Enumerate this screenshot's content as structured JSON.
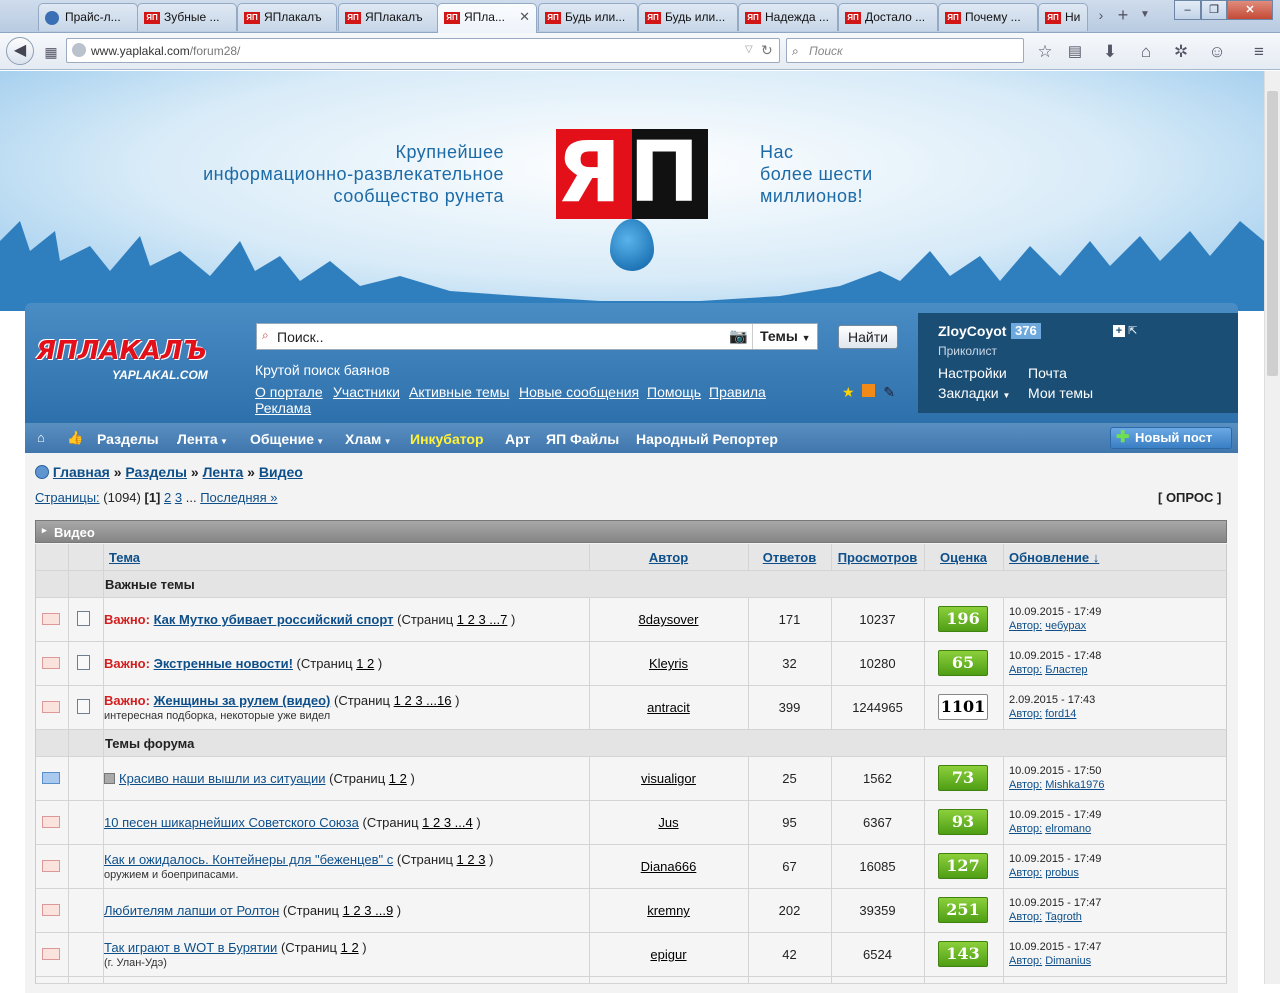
{
  "browser": {
    "tabs": [
      {
        "label": "Прайс-л...",
        "icon": "globe"
      },
      {
        "label": "Зубные ...",
        "icon": "ЯП"
      },
      {
        "label": "ЯПлакалъ",
        "icon": "ЯП"
      },
      {
        "label": "ЯПлакалъ",
        "icon": "ЯП"
      },
      {
        "label": "ЯПла...",
        "icon": "ЯП"
      },
      {
        "label": "Будь или...",
        "icon": "ЯП"
      },
      {
        "label": "Будь или...",
        "icon": "ЯП"
      },
      {
        "label": "Надежда ...",
        "icon": "ЯП"
      },
      {
        "label": "Достало ...",
        "icon": "ЯП"
      },
      {
        "label": "Почему ...",
        "icon": "ЯП"
      },
      {
        "label": "Ни",
        "icon": "ЯП"
      }
    ],
    "url_prefix": "www.yaplakal.com",
    "url_path": "/forum28/",
    "search_placeholder": "Поиск"
  },
  "hero": {
    "slogan_left": [
      "Крупнейшее",
      "информационно-развлекательное",
      "сообщество рунета"
    ],
    "slogan_right": [
      "Нас",
      "более шести",
      "миллионов!"
    ],
    "logo_text": "ЯП"
  },
  "header": {
    "site_logo": "ЯПЛАКАЛЪ",
    "site_logo_sub": "YAPLAKAL.COM",
    "search_placeholder": "Поиск..",
    "search_scope": "Темы",
    "search_button": "Найти",
    "tagline": "Крутой поиск баянов",
    "links": [
      "О портале",
      "Участники",
      "Активные темы",
      "Новые сообщения",
      "Помощь",
      "Правила",
      "Реклама"
    ]
  },
  "user": {
    "name": "ZloyCoyot",
    "karma": "376",
    "rank": "Приколист",
    "settings": "Настройки",
    "mail": "Почта",
    "bookmarks": "Закладки",
    "my_topics": "Мои темы"
  },
  "menu": {
    "items": [
      "Разделы",
      "Лента",
      "Общение",
      "Хлам",
      "Инкубатор",
      "Арт",
      "ЯП Файлы",
      "Народный Репортер"
    ],
    "new_post": "Новый пост"
  },
  "crumbs": [
    "Главная",
    "Разделы",
    "Лента",
    "Видео"
  ],
  "pager": {
    "label": "Страницы:",
    "count": "(1094)",
    "current": "[1]",
    "p2": "2",
    "p3": "3",
    "dots": "...",
    "last": "Последняя »",
    "poll": "[ ОПРОС ]"
  },
  "forum": {
    "title": "Видео",
    "columns": {
      "topic": "Тема",
      "author": "Автор",
      "replies": "Ответов",
      "views": "Просмотров",
      "rating": "Оценка",
      "updated": "Обновление ↓"
    },
    "section_important": "Важные темы",
    "section_topics": "Темы форума",
    "important_prefix": "Важно:",
    "pages_word": "(Страниц",
    "rows": [
      {
        "title": "Как Мутко убивает российский спорт",
        "pages": "1 2 3 ...7",
        "desc": "",
        "author": "8daysover",
        "replies": "171",
        "views": "10237",
        "rating": "196",
        "date": "10.09.2015 - 17:49",
        "by_label": "Автор:",
        "by": "чебурах",
        "important": true,
        "env": "red"
      },
      {
        "title": "Экстренные новости!",
        "pages": "1 2",
        "desc": "",
        "author": "Kleyris",
        "replies": "32",
        "views": "10280",
        "rating": "65",
        "date": "10.09.2015 - 17:48",
        "by_label": "Автор:",
        "by": "Бластер",
        "important": true,
        "env": "red"
      },
      {
        "title": "Женщины за рулем (видео)",
        "pages": "1 2 3 ...16",
        "desc": "интересная подборка, некоторые уже видел",
        "author": "antracit",
        "replies": "399",
        "views": "1244965",
        "rating": "1101",
        "date": "2.09.2015 - 17:43",
        "by_label": "Автор:",
        "by": "ford14",
        "important": true,
        "env": "red"
      },
      {
        "title": "Красиво наши вышли из ситуации",
        "pages": "1 2",
        "desc": "",
        "author": "visualigor",
        "replies": "25",
        "views": "1562",
        "rating": "73",
        "date": "10.09.2015 - 17:50",
        "by_label": "Автор:",
        "by": "Mishka1976",
        "important": false,
        "env": "blue"
      },
      {
        "title": "10 песен шикарнейших Советского Союза",
        "pages": "1 2 3 ...4",
        "desc": "",
        "author": "Jus",
        "replies": "95",
        "views": "6367",
        "rating": "93",
        "date": "10.09.2015 - 17:49",
        "by_label": "Автор:",
        "by": "elromano",
        "important": false,
        "env": "red"
      },
      {
        "title": "Как и ожидалось. Контейнеры для \"беженцев\" с",
        "pages": "1 2 3",
        "desc": "оружием и боеприпасами.",
        "author": "Diana666",
        "replies": "67",
        "views": "16085",
        "rating": "127",
        "date": "10.09.2015 - 17:49",
        "by_label": "Автор:",
        "by": "probus",
        "important": false,
        "env": "red"
      },
      {
        "title": "Любителям лапши от Ролтон",
        "pages": "1 2 3 ...9",
        "desc": "",
        "author": "kremny",
        "replies": "202",
        "views": "39359",
        "rating": "251",
        "date": "10.09.2015 - 17:47",
        "by_label": "Автор:",
        "by": "Tagroth",
        "important": false,
        "env": "red"
      },
      {
        "title": "Так играют в WOT в Бурятии",
        "pages": "1 2",
        "desc": "(г. Улан-Удэ)",
        "author": "epigur",
        "replies": "42",
        "views": "6524",
        "rating": "143",
        "date": "10.09.2015 - 17:47",
        "by_label": "Автор:",
        "by": "Dimanius",
        "important": false,
        "env": "red"
      }
    ]
  }
}
